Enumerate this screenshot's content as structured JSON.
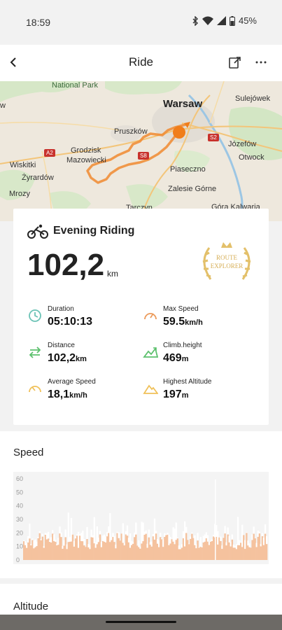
{
  "status_bar": {
    "time": "18:59",
    "battery": "45%",
    "icons": [
      "bluetooth-icon",
      "wifi-icon",
      "signal-icon",
      "battery-icon"
    ]
  },
  "app_bar": {
    "title": "Ride",
    "back_icon": "back-arrow-icon",
    "share_icon": "share-icon",
    "more_icon": "more-icon"
  },
  "map": {
    "labels": [
      "National Park",
      "Warsaw",
      "Sulejówek",
      "Pruszków",
      "S2",
      "Grodzisk",
      "Mazowiecki",
      "S8",
      "Józefów",
      "A2",
      "Wiskitki",
      "Otwock",
      "Piaseczno",
      "Żyrardów",
      "Zalesie Górne",
      "Mrozy",
      "Tarczyn",
      "Góra Kalwaria",
      "w"
    ],
    "route_color": "#f08a30"
  },
  "summary": {
    "ride_name": "Evening Riding",
    "distance_value": "102,2",
    "distance_unit": "km",
    "badge_line1": "ROUTE",
    "badge_line2": "EXPLORER",
    "stats": [
      {
        "label": "Duration",
        "value": "05:10:13",
        "unit": "",
        "icon": "clock-icon"
      },
      {
        "label": "Max Speed",
        "value": "59.5",
        "unit": "km/h",
        "icon": "speedometer-icon"
      },
      {
        "label": "Distance",
        "value": "102,2",
        "unit": "km",
        "icon": "distance-arrows-icon"
      },
      {
        "label": "Climb.height",
        "value": "469",
        "unit": "m",
        "icon": "climb-icon"
      },
      {
        "label": "Average Speed",
        "value": "18,1",
        "unit": "km/h",
        "icon": "gauge-icon"
      },
      {
        "label": "Highest Altitude",
        "value": "197",
        "unit": "m",
        "icon": "mountain-icon"
      }
    ]
  },
  "speed": {
    "title": "Speed",
    "chart_data": {
      "type": "area",
      "title": "",
      "xlabel": "",
      "ylabel": "",
      "ylim": [
        0,
        60
      ],
      "y_ticks": [
        "60",
        "50",
        "40",
        "30",
        "20",
        "10",
        "0"
      ],
      "fill_color": "#f5c29e",
      "peak_color": "#ffffff",
      "typical_speed_range": [
        8,
        20
      ],
      "max_speed": 59.5
    }
  },
  "altitude": {
    "title": "Altitude"
  }
}
